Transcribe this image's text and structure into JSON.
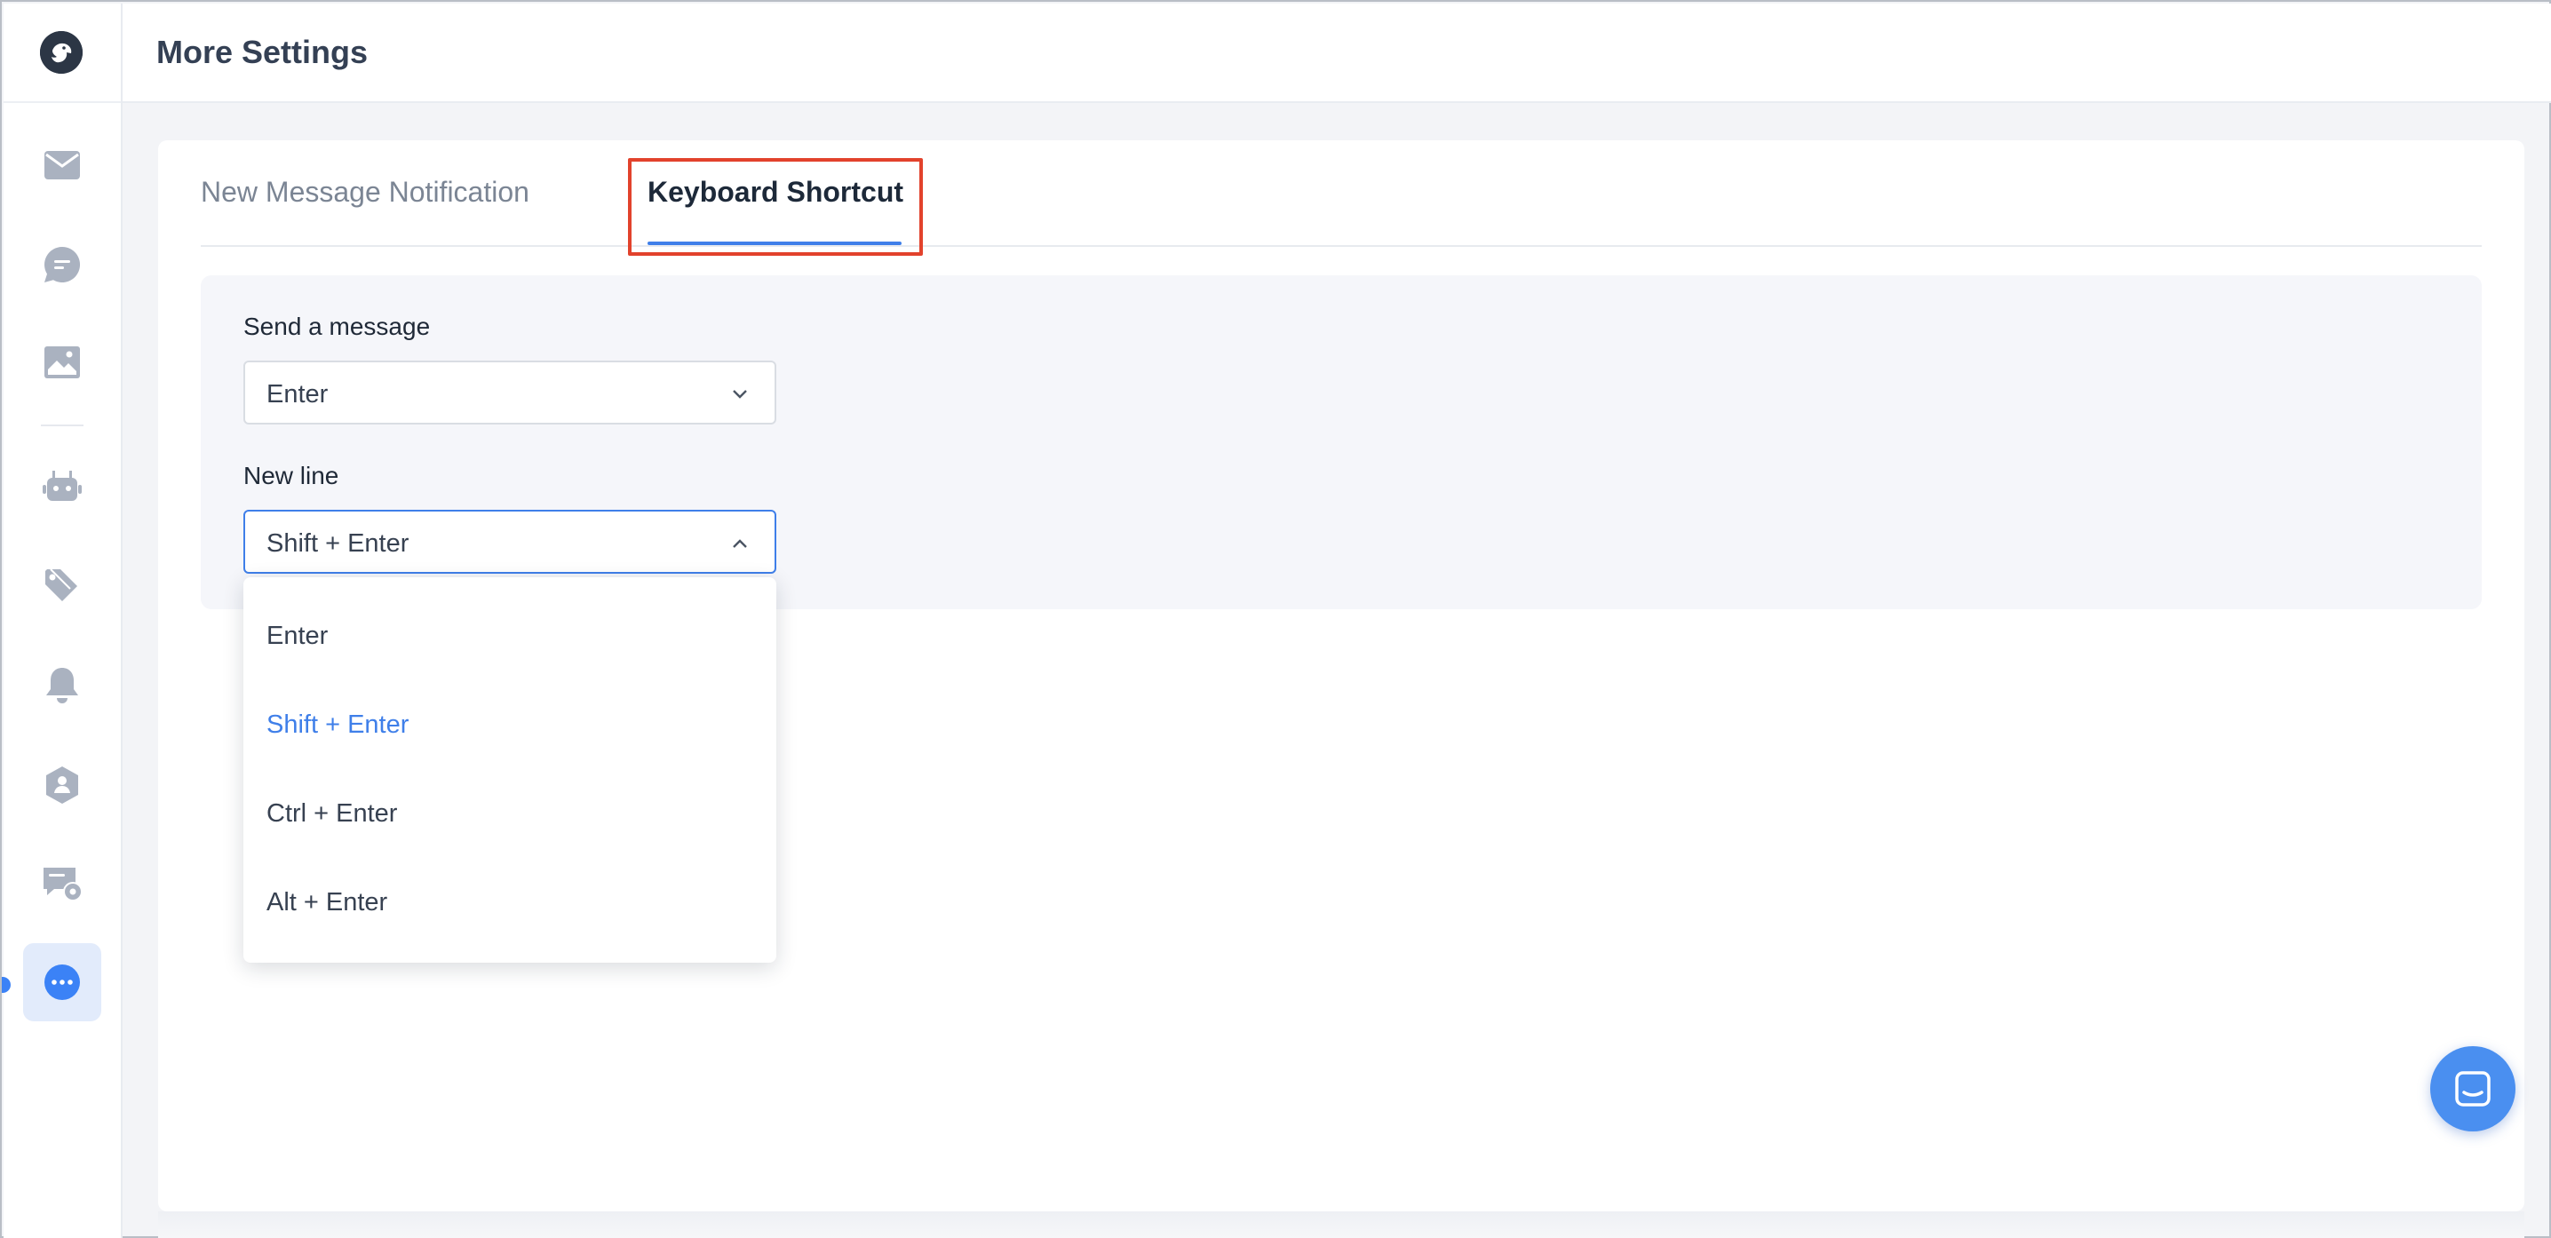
{
  "header": {
    "title": "More Settings"
  },
  "sidebar": {
    "logo_icon": "parrot-logo-icon",
    "items": [
      {
        "name": "inbox",
        "icon": "envelope-icon"
      },
      {
        "name": "conversations",
        "icon": "chat-bubble-icon"
      },
      {
        "name": "media",
        "icon": "image-icon"
      },
      {
        "name": "bots",
        "icon": "robot-icon"
      },
      {
        "name": "tags",
        "icon": "tags-icon"
      },
      {
        "name": "notifications",
        "icon": "bell-icon"
      },
      {
        "name": "contacts",
        "icon": "user-shield-icon"
      },
      {
        "name": "chat-settings",
        "icon": "chat-gear-icon"
      },
      {
        "name": "more-settings",
        "icon": "ellipsis-circle-icon",
        "active": true
      }
    ]
  },
  "tabs": [
    {
      "label": "New Message Notification",
      "active": false
    },
    {
      "label": "Keyboard Shortcut",
      "active": true
    }
  ],
  "shortcuts": {
    "send": {
      "label": "Send a message",
      "value": "Enter"
    },
    "newline": {
      "label": "New line",
      "value": "Shift + Enter",
      "open": true
    }
  },
  "dropdown": {
    "options": [
      "Enter",
      "Shift + Enter",
      "Ctrl + Enter",
      "Alt + Enter"
    ],
    "selected": "Shift + Enter"
  },
  "colors": {
    "accent": "#3f7fe9",
    "highlight": "#e2422c",
    "sidebar_icon": "#aab2c0"
  },
  "chat_widget": {
    "icon": "chat-window-icon"
  }
}
